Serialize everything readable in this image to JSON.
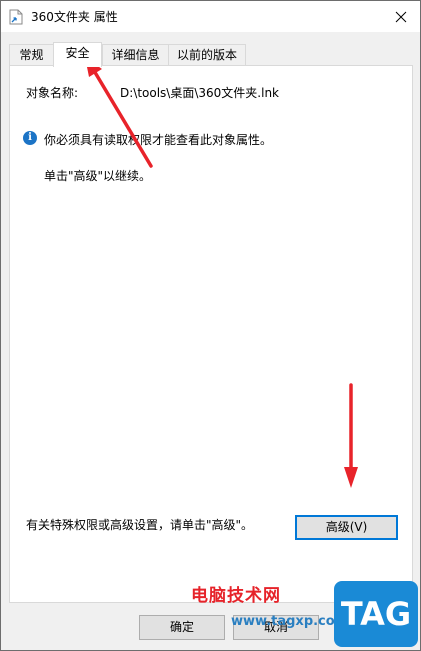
{
  "window": {
    "title": "360文件夹 属性",
    "close_icon": "close-icon"
  },
  "tabs": [
    {
      "label": "常规",
      "active": false
    },
    {
      "label": "安全",
      "active": true
    },
    {
      "label": "详细信息",
      "active": false
    },
    {
      "label": "以前的版本",
      "active": false
    }
  ],
  "security": {
    "object_label": "对象名称:",
    "object_value": "D:\\tools\\桌面\\360文件夹.lnk",
    "info_message": "你必须具有读取权限才能查看此对象属性。",
    "hint_message": "单击\"高级\"以继续。",
    "footer_message": "有关特殊权限或高级设置，请单击\"高级\"。",
    "advanced_button": "高级(V)"
  },
  "buttons": {
    "ok": "确定",
    "cancel": "取消"
  },
  "watermark": {
    "site_name": "电脑技术网",
    "site_url": "www.tagxp.com",
    "logo_text": "TAG",
    "suffix": "极光下载站"
  },
  "colors": {
    "annotation_arrow": "#e8232a",
    "focus_border": "#0078d7",
    "info_icon": "#1c74c6"
  }
}
